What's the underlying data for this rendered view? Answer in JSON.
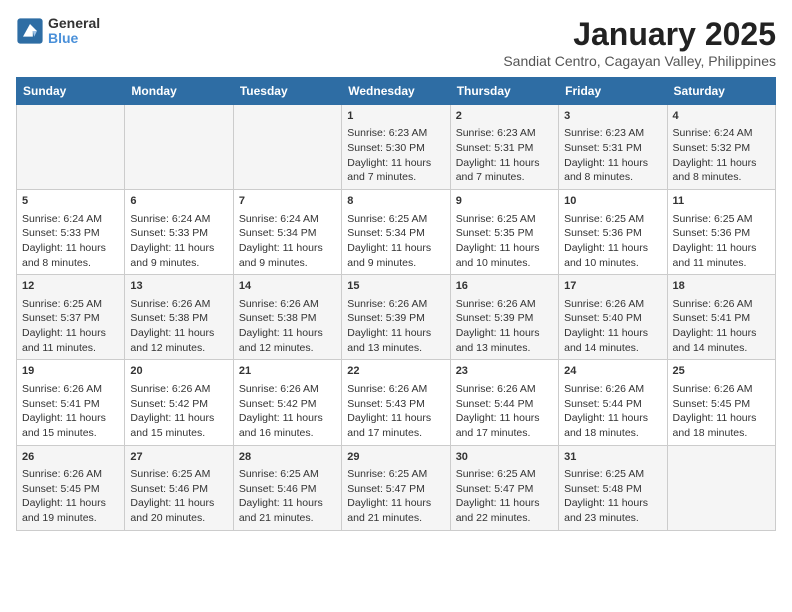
{
  "header": {
    "logo_text_top": "General",
    "logo_text_bottom": "Blue",
    "month_year": "January 2025",
    "location": "Sandiat Centro, Cagayan Valley, Philippines"
  },
  "weekdays": [
    "Sunday",
    "Monday",
    "Tuesday",
    "Wednesday",
    "Thursday",
    "Friday",
    "Saturday"
  ],
  "weeks": [
    [
      {
        "day": "",
        "info": ""
      },
      {
        "day": "",
        "info": ""
      },
      {
        "day": "",
        "info": ""
      },
      {
        "day": "1",
        "info": "Sunrise: 6:23 AM\nSunset: 5:30 PM\nDaylight: 11 hours and 7 minutes."
      },
      {
        "day": "2",
        "info": "Sunrise: 6:23 AM\nSunset: 5:31 PM\nDaylight: 11 hours and 7 minutes."
      },
      {
        "day": "3",
        "info": "Sunrise: 6:23 AM\nSunset: 5:31 PM\nDaylight: 11 hours and 8 minutes."
      },
      {
        "day": "4",
        "info": "Sunrise: 6:24 AM\nSunset: 5:32 PM\nDaylight: 11 hours and 8 minutes."
      }
    ],
    [
      {
        "day": "5",
        "info": "Sunrise: 6:24 AM\nSunset: 5:33 PM\nDaylight: 11 hours and 8 minutes."
      },
      {
        "day": "6",
        "info": "Sunrise: 6:24 AM\nSunset: 5:33 PM\nDaylight: 11 hours and 9 minutes."
      },
      {
        "day": "7",
        "info": "Sunrise: 6:24 AM\nSunset: 5:34 PM\nDaylight: 11 hours and 9 minutes."
      },
      {
        "day": "8",
        "info": "Sunrise: 6:25 AM\nSunset: 5:34 PM\nDaylight: 11 hours and 9 minutes."
      },
      {
        "day": "9",
        "info": "Sunrise: 6:25 AM\nSunset: 5:35 PM\nDaylight: 11 hours and 10 minutes."
      },
      {
        "day": "10",
        "info": "Sunrise: 6:25 AM\nSunset: 5:36 PM\nDaylight: 11 hours and 10 minutes."
      },
      {
        "day": "11",
        "info": "Sunrise: 6:25 AM\nSunset: 5:36 PM\nDaylight: 11 hours and 11 minutes."
      }
    ],
    [
      {
        "day": "12",
        "info": "Sunrise: 6:25 AM\nSunset: 5:37 PM\nDaylight: 11 hours and 11 minutes."
      },
      {
        "day": "13",
        "info": "Sunrise: 6:26 AM\nSunset: 5:38 PM\nDaylight: 11 hours and 12 minutes."
      },
      {
        "day": "14",
        "info": "Sunrise: 6:26 AM\nSunset: 5:38 PM\nDaylight: 11 hours and 12 minutes."
      },
      {
        "day": "15",
        "info": "Sunrise: 6:26 AM\nSunset: 5:39 PM\nDaylight: 11 hours and 13 minutes."
      },
      {
        "day": "16",
        "info": "Sunrise: 6:26 AM\nSunset: 5:39 PM\nDaylight: 11 hours and 13 minutes."
      },
      {
        "day": "17",
        "info": "Sunrise: 6:26 AM\nSunset: 5:40 PM\nDaylight: 11 hours and 14 minutes."
      },
      {
        "day": "18",
        "info": "Sunrise: 6:26 AM\nSunset: 5:41 PM\nDaylight: 11 hours and 14 minutes."
      }
    ],
    [
      {
        "day": "19",
        "info": "Sunrise: 6:26 AM\nSunset: 5:41 PM\nDaylight: 11 hours and 15 minutes."
      },
      {
        "day": "20",
        "info": "Sunrise: 6:26 AM\nSunset: 5:42 PM\nDaylight: 11 hours and 15 minutes."
      },
      {
        "day": "21",
        "info": "Sunrise: 6:26 AM\nSunset: 5:42 PM\nDaylight: 11 hours and 16 minutes."
      },
      {
        "day": "22",
        "info": "Sunrise: 6:26 AM\nSunset: 5:43 PM\nDaylight: 11 hours and 17 minutes."
      },
      {
        "day": "23",
        "info": "Sunrise: 6:26 AM\nSunset: 5:44 PM\nDaylight: 11 hours and 17 minutes."
      },
      {
        "day": "24",
        "info": "Sunrise: 6:26 AM\nSunset: 5:44 PM\nDaylight: 11 hours and 18 minutes."
      },
      {
        "day": "25",
        "info": "Sunrise: 6:26 AM\nSunset: 5:45 PM\nDaylight: 11 hours and 18 minutes."
      }
    ],
    [
      {
        "day": "26",
        "info": "Sunrise: 6:26 AM\nSunset: 5:45 PM\nDaylight: 11 hours and 19 minutes."
      },
      {
        "day": "27",
        "info": "Sunrise: 6:25 AM\nSunset: 5:46 PM\nDaylight: 11 hours and 20 minutes."
      },
      {
        "day": "28",
        "info": "Sunrise: 6:25 AM\nSunset: 5:46 PM\nDaylight: 11 hours and 21 minutes."
      },
      {
        "day": "29",
        "info": "Sunrise: 6:25 AM\nSunset: 5:47 PM\nDaylight: 11 hours and 21 minutes."
      },
      {
        "day": "30",
        "info": "Sunrise: 6:25 AM\nSunset: 5:47 PM\nDaylight: 11 hours and 22 minutes."
      },
      {
        "day": "31",
        "info": "Sunrise: 6:25 AM\nSunset: 5:48 PM\nDaylight: 11 hours and 23 minutes."
      },
      {
        "day": "",
        "info": ""
      }
    ]
  ]
}
